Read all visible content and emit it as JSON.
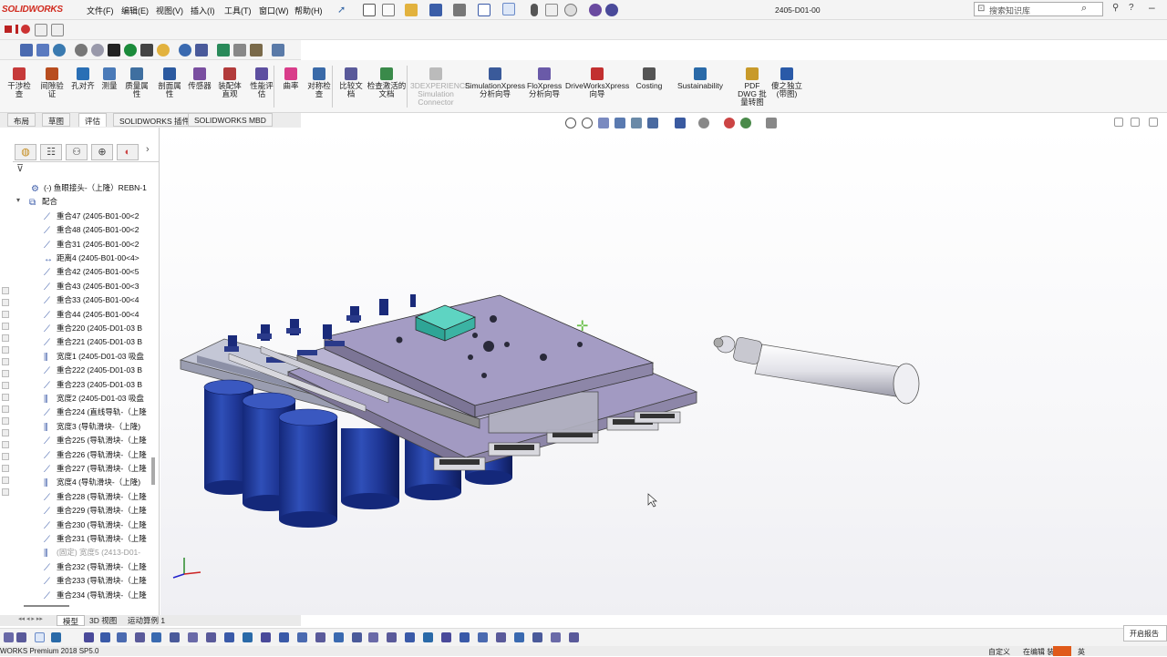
{
  "app": {
    "logo": "SOLIDWORKS",
    "doc_title": "2405-D01-00",
    "menu": [
      "文件(F)",
      "编辑(E)",
      "视图(V)",
      "插入(I)",
      "工具(T)",
      "窗口(W)",
      "帮助(H)"
    ],
    "search_placeholder": "搜索知识库"
  },
  "ribbon": {
    "items": [
      {
        "label": "干涉检查",
        "icon": "interference-icon",
        "color": "#c63a3a"
      },
      {
        "label": "间隙验证",
        "icon": "clearance-icon",
        "color": "#b84d1f"
      },
      {
        "label": "孔对齐",
        "icon": "hole-align-icon",
        "color": "#2a6fb5"
      },
      {
        "label": "测量",
        "icon": "measure-icon",
        "color": "#4a7ab8"
      },
      {
        "label": "质量属性",
        "icon": "mass-properties-icon",
        "color": "#3f6fa0"
      },
      {
        "label": "剖面属性",
        "icon": "section-properties-icon",
        "color": "#2c5aa0"
      },
      {
        "label": "传感器",
        "icon": "sensor-icon",
        "color": "#7a4fa0"
      },
      {
        "label": "装配体直观",
        "icon": "assembly-visualization-icon",
        "color": "#b23b3b"
      },
      {
        "label": "性能评估",
        "icon": "performance-icon",
        "color": "#5d4fa0"
      },
      {
        "label": "曲率",
        "icon": "curvature-icon",
        "color": "#d93d8a"
      },
      {
        "label": "对称检查",
        "icon": "symmetry-icon",
        "color": "#3a6aa8"
      },
      {
        "label": "比较文档",
        "icon": "compare-icon",
        "color": "#5a5a9a"
      },
      {
        "label": "检查激活的文档",
        "icon": "check-document-icon",
        "color": "#3a8a4a"
      },
      {
        "label": "3DEXPERIENCE Simulation Connector",
        "icon": "simulation-connector-icon",
        "color": "#bbbbbb",
        "disabled": true
      },
      {
        "label": "SimulationXpress 分析向导",
        "icon": "simulationxpress-icon",
        "color": "#3a5a9a"
      },
      {
        "label": "FloXpress 分析向导",
        "icon": "floxpress-icon",
        "color": "#6a5aa8"
      },
      {
        "label": "DriveWorksXpress 向导",
        "icon": "driveworks-icon",
        "color": "#c23030"
      },
      {
        "label": "Costing",
        "icon": "costing-icon",
        "color": "#555"
      },
      {
        "label": "Sustainability",
        "icon": "sustainability-icon",
        "color": "#2a6aa8"
      },
      {
        "label": "PDF DWG 批量转图",
        "icon": "pdf-dwg-icon",
        "color": "#c89a2a"
      },
      {
        "label": "傻之独立(带图)",
        "icon": "plugin-icon",
        "color": "#2a5aa8"
      }
    ]
  },
  "tabs": [
    "布局",
    "草图",
    "评估",
    "SOLIDWORKS 插件",
    "SOLIDWORKS MBD"
  ],
  "active_tab": "评估",
  "tree": {
    "items": [
      {
        "label": "(-) 鱼眼接头-（上隆）REBN-1",
        "icon": "part-icon",
        "indent": 0,
        "gray": false
      },
      {
        "label": "配合",
        "icon": "mates-folder-icon",
        "indent": -1,
        "gray": false
      },
      {
        "label": "重合47 (2405-B01-00<2",
        "icon": "coincident-icon",
        "indent": 1,
        "gray": false
      },
      {
        "label": "重合48 (2405-B01-00<2",
        "icon": "coincident-icon",
        "indent": 1,
        "gray": false
      },
      {
        "label": "重合31 (2405-B01-00<2",
        "icon": "coincident-icon",
        "indent": 1,
        "gray": false
      },
      {
        "label": "距离4 (2405-B01-00<4>",
        "icon": "distance-icon",
        "indent": 1,
        "gray": false
      },
      {
        "label": "重合42 (2405-B01-00<5",
        "icon": "coincident-icon",
        "indent": 1,
        "gray": false
      },
      {
        "label": "重合43 (2405-B01-00<3",
        "icon": "coincident-icon",
        "indent": 1,
        "gray": false
      },
      {
        "label": "重合33 (2405-B01-00<4",
        "icon": "coincident-icon",
        "indent": 1,
        "gray": false
      },
      {
        "label": "重合44 (2405-B01-00<4",
        "icon": "coincident-icon",
        "indent": 1,
        "gray": false
      },
      {
        "label": "重合220 (2405-D01-03 B",
        "icon": "coincident-icon",
        "indent": 1,
        "gray": false
      },
      {
        "label": "重合221 (2405-D01-03 B",
        "icon": "coincident-icon",
        "indent": 1,
        "gray": false
      },
      {
        "label": "宽度1 (2405-D01-03 吸盘",
        "icon": "width-icon",
        "indent": 1,
        "gray": false
      },
      {
        "label": "重合222 (2405-D01-03 B",
        "icon": "coincident-icon",
        "indent": 1,
        "gray": false
      },
      {
        "label": "重合223 (2405-D01-03 B",
        "icon": "coincident-icon",
        "indent": 1,
        "gray": false
      },
      {
        "label": "宽度2 (2405-D01-03 吸盘",
        "icon": "width-icon",
        "indent": 1,
        "gray": false
      },
      {
        "label": "重合224 (直线导轨-（上隆",
        "icon": "coincident-icon",
        "indent": 1,
        "gray": false
      },
      {
        "label": "宽度3 (导轨滑块-（上隆)",
        "icon": "width-icon",
        "indent": 1,
        "gray": false
      },
      {
        "label": "重合225 (导轨滑块-（上隆",
        "icon": "coincident-icon",
        "indent": 1,
        "gray": false
      },
      {
        "label": "重合226 (导轨滑块-（上隆",
        "icon": "coincident-icon",
        "indent": 1,
        "gray": false
      },
      {
        "label": "重合227 (导轨滑块-（上隆",
        "icon": "coincident-icon",
        "indent": 1,
        "gray": false
      },
      {
        "label": "宽度4 (导轨滑块-（上隆)",
        "icon": "width-icon",
        "indent": 1,
        "gray": false
      },
      {
        "label": "重合228 (导轨滑块-（上隆",
        "icon": "coincident-icon",
        "indent": 1,
        "gray": false
      },
      {
        "label": "重合229 (导轨滑块-（上隆",
        "icon": "coincident-icon",
        "indent": 1,
        "gray": false
      },
      {
        "label": "重合230 (导轨滑块-（上隆",
        "icon": "coincident-icon",
        "indent": 1,
        "gray": false
      },
      {
        "label": "重合231 (导轨滑块-（上隆",
        "icon": "coincident-icon",
        "indent": 1,
        "gray": false
      },
      {
        "label": "(固定) 宽度5 (2413-D01-",
        "icon": "width-icon",
        "indent": 1,
        "gray": true
      },
      {
        "label": "重合232 (导轨滑块-（上隆",
        "icon": "coincident-icon",
        "indent": 1,
        "gray": false
      },
      {
        "label": "重合233 (导轨滑块-（上隆",
        "icon": "coincident-icon",
        "indent": 1,
        "gray": false
      },
      {
        "label": "重合234 (导轨滑块-（上隆",
        "icon": "coincident-icon",
        "indent": 1,
        "gray": false
      }
    ]
  },
  "bottom_tabs": [
    "模型",
    "3D 视图",
    "运动算例 1"
  ],
  "status": {
    "left": "WORKS Premium 2018 SP5.0",
    "custom": "自定义",
    "editing": "在编辑 装",
    "ime": "英",
    "notify": "开启报告"
  },
  "colors": {
    "plate": "#a49cc4",
    "plate_dark": "#7c7596",
    "cylinder": "#1f3796",
    "frame": "#b9bccb",
    "sensor": "#3bb3a3",
    "logo_red": "#d12a1e"
  }
}
